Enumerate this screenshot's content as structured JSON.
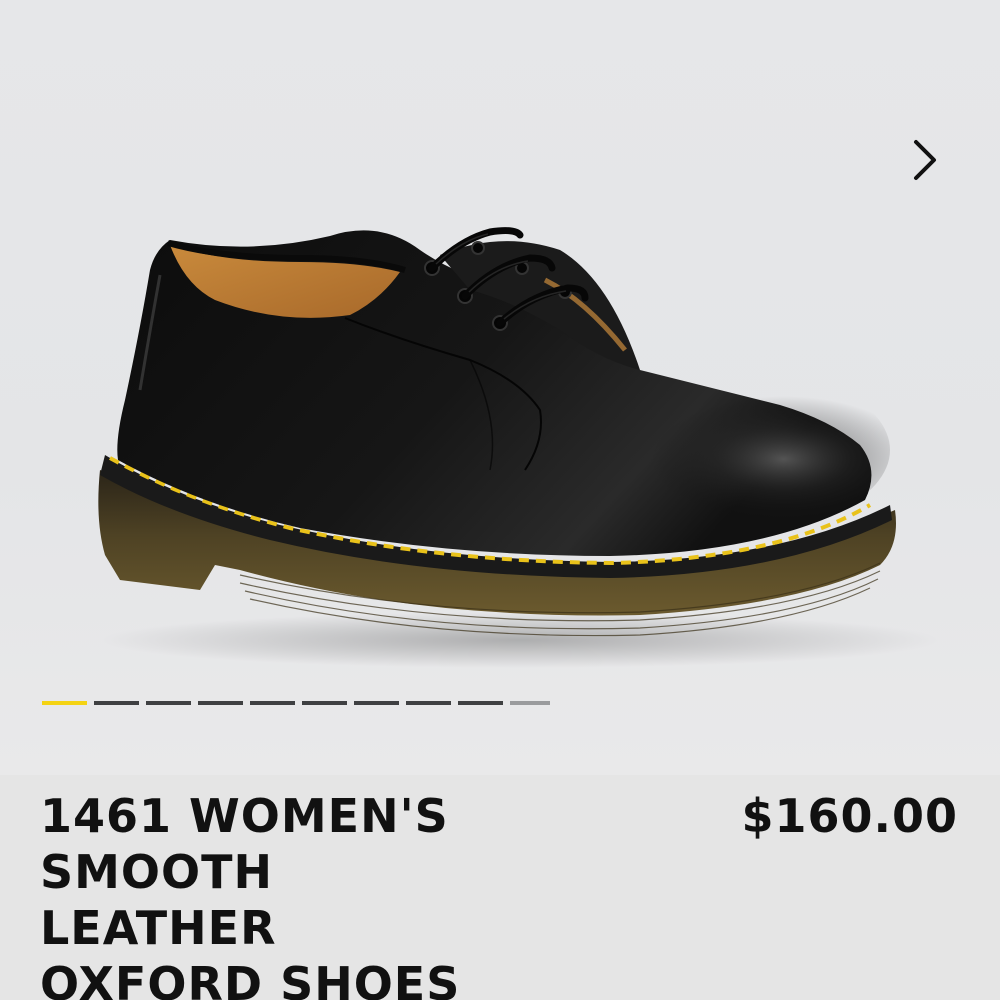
{
  "gallery": {
    "image_alt": "black smooth leather oxford shoe",
    "next_icon": "chevron-right-icon",
    "slide_count": 10,
    "active_index": 0,
    "indicator_active_color": "#f4d313",
    "indicator_color": "#3f4042"
  },
  "product": {
    "title_lines": [
      "1461 WOMEN'S",
      "SMOOTH",
      "LEATHER",
      "OXFORD SHOES"
    ],
    "price": "$160.00"
  }
}
